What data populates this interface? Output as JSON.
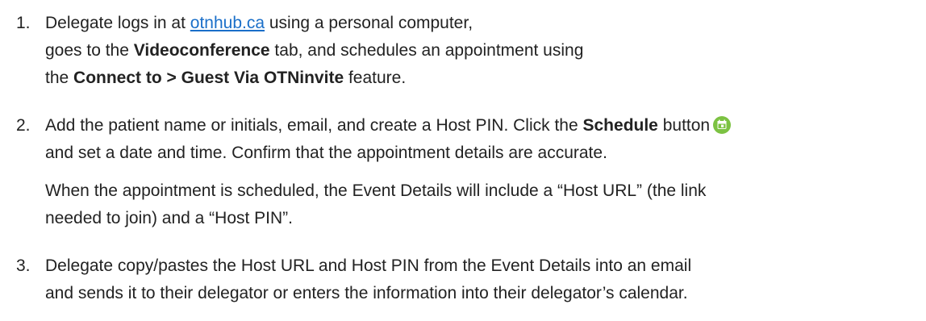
{
  "colors": {
    "text": "#222222",
    "link": "#1a6fc9",
    "icon_bg": "#7cc242"
  },
  "steps": [
    {
      "number": "1.",
      "lines": [
        {
          "pre": "Delegate logs in at ",
          "link": "otnhub.ca",
          "post": " using a personal computer,"
        },
        {
          "pre": "goes to the ",
          "bold": "Videoconference",
          "post": " tab, and schedules an appointment using"
        },
        {
          "pre": "the ",
          "bold": "Connect to > Guest Via OTNinvite",
          "post": " feature."
        }
      ]
    },
    {
      "number": "2.",
      "line1": {
        "pre": "Add the patient name or initials, email, and create a Host PIN. Click the ",
        "bold": "Schedule",
        "post": " button",
        "icon": "calendar-icon"
      },
      "line2": "and set a date and time. Confirm that the appointment details are accurate.",
      "para2_line1": "When the appointment is scheduled, the Event Details will include a “Host URL” (the link",
      "para2_line2": "needed to join) and a “Host PIN”."
    },
    {
      "number": "3.",
      "line1": "Delegate copy/pastes the Host URL and Host PIN from the Event Details into an email",
      "line2": "and sends it to their delegator or enters the information into their delegator’s calendar."
    }
  ]
}
